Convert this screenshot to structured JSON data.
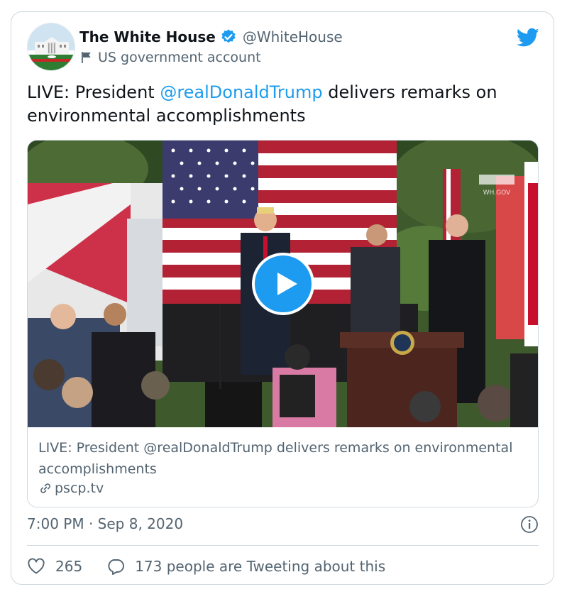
{
  "author": {
    "name": "The White House",
    "handle": "@WhiteHouse",
    "account_label": "US government account"
  },
  "tweet": {
    "text_prefix": "LIVE: President ",
    "mention": "@realDonaldTrump",
    "text_suffix": " delivers remarks on environmental accomplishments"
  },
  "media_card": {
    "title": "LIVE: President @realDonaldTrump delivers remarks on environmental accomplishments",
    "domain": "pscp.tv",
    "watermark": "WH.GOV"
  },
  "meta": {
    "time": "7:00 PM",
    "separator": " · ",
    "date": "Sep 8, 2020"
  },
  "actions": {
    "likes": "265",
    "reply_label": "173 people are Tweeting about this"
  },
  "icons": {
    "verified": "verified-badge-icon",
    "government": "flag-icon",
    "twitter": "twitter-bird-icon",
    "play": "play-icon",
    "link": "link-icon",
    "info": "info-icon",
    "like": "heart-icon",
    "reply": "speech-bubble-icon"
  },
  "colors": {
    "accent": "#1d9bf0",
    "text": "#0f1419",
    "secondary": "#536471",
    "border": "#cfd9de"
  }
}
